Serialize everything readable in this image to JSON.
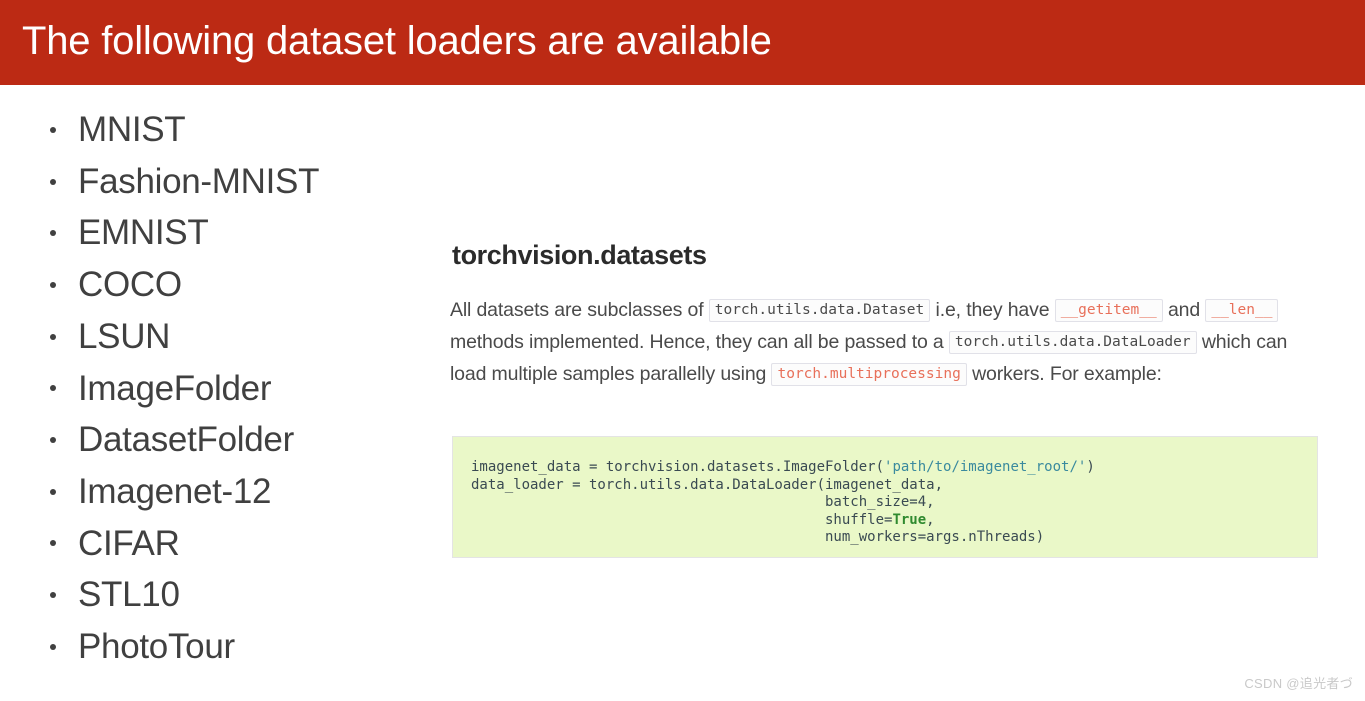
{
  "slide": {
    "title": "The following dataset loaders are available",
    "header_bg": "#bc2a14",
    "title_color": "#ffffff",
    "body_bg": "#ffffff"
  },
  "dataset_list": [
    {
      "label": "MNIST"
    },
    {
      "label": "Fashion-MNIST"
    },
    {
      "label": "EMNIST"
    },
    {
      "label": "COCO"
    },
    {
      "label": "LSUN"
    },
    {
      "label": "ImageFolder"
    },
    {
      "label": "DatasetFolder"
    },
    {
      "label": "Imagenet-12"
    },
    {
      "label": "CIFAR"
    },
    {
      "label": "STL10"
    },
    {
      "label": "PhotoTour"
    }
  ],
  "doc": {
    "heading": "torchvision.datasets",
    "paragraph": {
      "t1": "All datasets are subclasses of ",
      "c1": "torch.utils.data.Dataset",
      "t2": " i.e, they have ",
      "c2": "__getitem__",
      "t3": " and ",
      "c3": "__len__",
      "t4": " methods implemented. Hence, they can all be passed to a ",
      "c4": "torch.utils.data.DataLoader",
      "t5": " which can load multiple samples parallelly using ",
      "c5": "torch.multiprocessing",
      "t6": " workers. For example:"
    },
    "accent_code_color": "#e8705a",
    "code_block": {
      "bg": "#eaf8c8",
      "l1a": "imagenet_data = torchvision.datasets.ImageFolder(",
      "l1b": "'path/to/imagenet_root/'",
      "l1c": ")",
      "l2": "data_loader = torch.utils.data.DataLoader(imagenet_data,",
      "l3": "                                          batch_size=4,",
      "l4a": "                                          shuffle=",
      "l4b": "True",
      "l4c": ",",
      "l5": "                                          num_workers=args.nThreads)",
      "string_color": "#3a8a9e",
      "bool_color": "#2f8a2f"
    }
  },
  "watermark": {
    "text": "CSDN @追光者づ"
  }
}
